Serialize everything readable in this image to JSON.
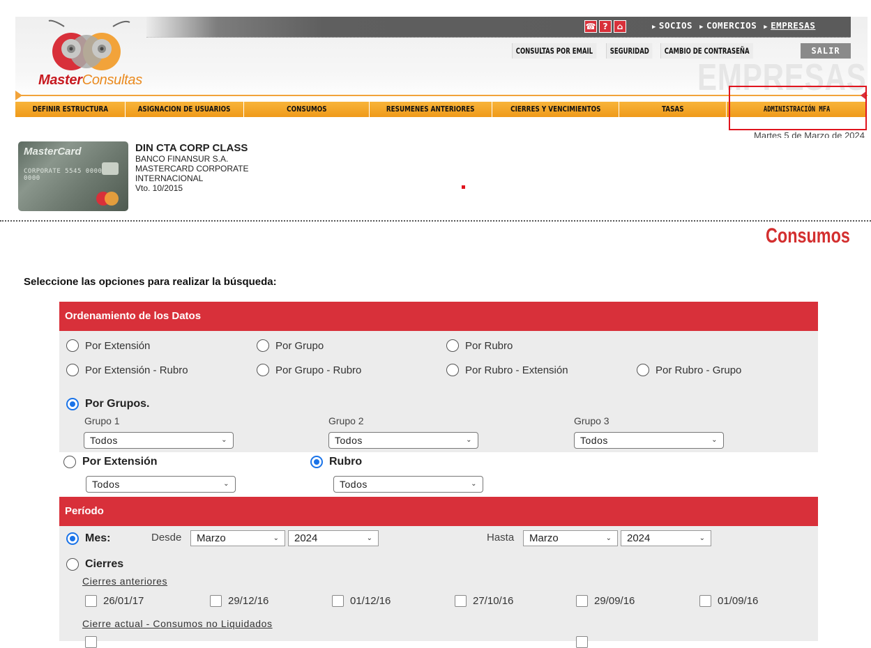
{
  "header": {
    "icons": [
      "phone-icon",
      "help-icon",
      "home-icon"
    ],
    "icon_glyphs": {
      "phone": "☎",
      "help": "?",
      "home": "⌂"
    },
    "top_links": [
      {
        "label": "SOCIOS",
        "underlined": false
      },
      {
        "label": "COMERCIOS",
        "underlined": false
      },
      {
        "label": "EMPRESAS",
        "underlined": true
      }
    ],
    "sub_links": [
      "CONSULTAS POR EMAIL",
      "SEGURIDAD",
      "CAMBIO DE CONTRASEÑA"
    ],
    "logout": "SALIR",
    "watermark": "EMPRESAS",
    "logo_bold": "Master",
    "logo_light": "Consultas"
  },
  "nav": {
    "items": [
      "DEFINIR ESTRUCTURA",
      "ASIGNACION DE USUARIOS",
      "CONSUMOS",
      "RESUMENES ANTERIORES",
      "CIERRES Y VENCIMIENTOS",
      "TASAS",
      "ADMINISTRACIÓN MFA"
    ]
  },
  "date": "Martes 5 de Marzo de 2024",
  "card": {
    "brand": "MasterCard",
    "number_text": "CORPORATE 5545 0000 2 0000",
    "title": "DIN CTA CORP CLASS",
    "lines": [
      "BANCO FINANSUR S.A.",
      "MASTERCARD CORPORATE",
      "INTERNACIONAL",
      "Vto. 10/2015"
    ]
  },
  "page_title": "Consumos",
  "instructions": "Seleccione las opciones para realizar la búsqueda:",
  "ordenamiento": {
    "title": "Ordenamiento de los Datos",
    "options_row1": [
      "Por Extensión",
      "Por Grupo",
      "Por Rubro"
    ],
    "options_row2": [
      "Por Extensión - Rubro",
      "Por Grupo - Rubro",
      "Por Rubro - Extensión",
      "Por Rubro - Grupo"
    ],
    "por_grupos": "Por Grupos.",
    "grupo_labels": [
      "Grupo 1",
      "Grupo 2",
      "Grupo 3"
    ],
    "grupo_values": [
      "Todos",
      "Todos",
      "Todos"
    ],
    "por_extension": "Por Extensión",
    "por_extension_value": "Todos",
    "rubro": "Rubro",
    "rubro_value": "Todos"
  },
  "periodo": {
    "title": "Período",
    "mes_label": "Mes:",
    "desde_label": "Desde",
    "desde_mes": "Marzo",
    "desde_anio": "2024",
    "hasta_label": "Hasta",
    "hasta_mes": "Marzo",
    "hasta_anio": "2024",
    "cierres_label": "Cierres",
    "cierres_anteriores_label": "Cierres anteriores",
    "cierres_anteriores": [
      "26/01/17",
      "29/12/16",
      "01/12/16",
      "27/10/16",
      "29/09/16",
      "01/09/16"
    ],
    "cierre_actual_label": "Cierre actual - Consumos no Liquidados"
  }
}
